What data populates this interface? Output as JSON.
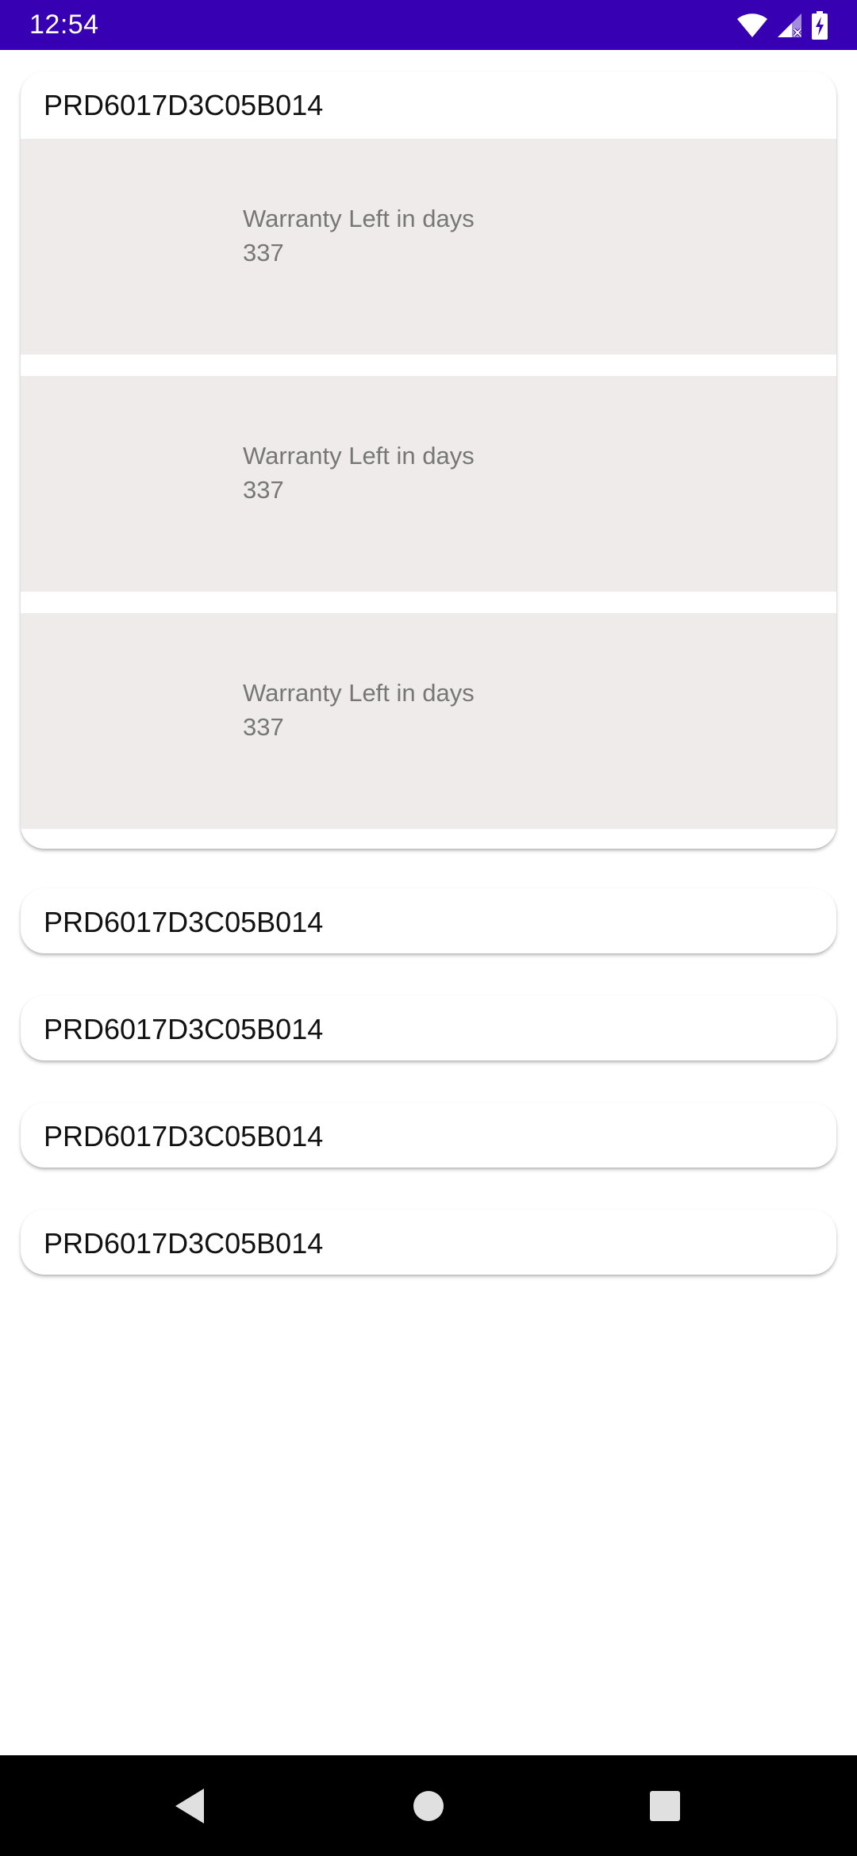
{
  "status_bar": {
    "time": "12:54",
    "icons": [
      "wifi-icon",
      "cellular-no-data-icon",
      "battery-charging-icon"
    ],
    "background": "#3700b3"
  },
  "products": [
    {
      "id": "PRD6017D3C05B014",
      "expanded": true,
      "items": [
        {
          "label": "Warranty Left in days",
          "value": "337"
        },
        {
          "label": "Warranty Left in days",
          "value": "337"
        },
        {
          "label": "Warranty Left in days",
          "value": "337"
        }
      ]
    },
    {
      "id": "PRD6017D3C05B014",
      "expanded": false
    },
    {
      "id": "PRD6017D3C05B014",
      "expanded": false
    },
    {
      "id": "PRD6017D3C05B014",
      "expanded": false
    },
    {
      "id": "PRD6017D3C05B014",
      "expanded": false
    }
  ],
  "nav_bar": {
    "buttons": [
      "back-icon",
      "home-icon",
      "recents-icon"
    ]
  },
  "colors": {
    "panel_background": "#f0ebeb",
    "panel_text": "#777777",
    "title_text": "#111111"
  }
}
